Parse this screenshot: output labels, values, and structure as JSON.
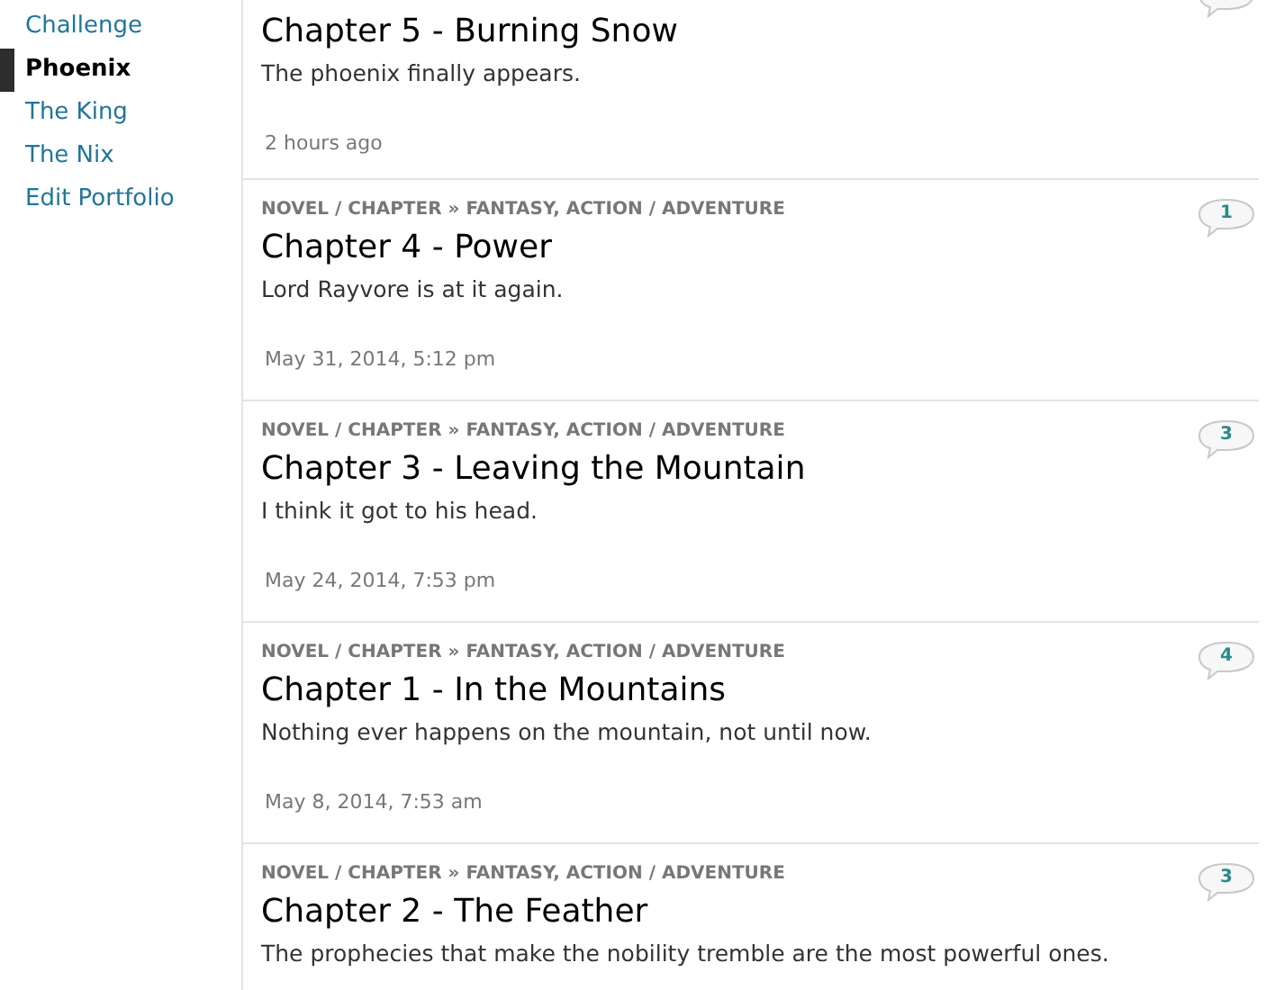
{
  "sidebar": {
    "items": [
      {
        "label": "Challenge",
        "selected": false
      },
      {
        "label": "Phoenix",
        "selected": true
      },
      {
        "label": "The King",
        "selected": false
      },
      {
        "label": "The Nix",
        "selected": false
      },
      {
        "label": "Edit Portfolio",
        "selected": false
      }
    ]
  },
  "posts": [
    {
      "title": "Chapter 5 - Burning Snow",
      "summary": "The phoenix finally appears.",
      "date": "2 hours ago"
    },
    {
      "meta": "NOVEL / CHAPTER » FANTASY, ACTION / ADVENTURE",
      "title": "Chapter 4 - Power",
      "summary": "Lord Rayvore is at it again.",
      "date": "May 31, 2014, 5:12 pm",
      "comments": "1"
    },
    {
      "meta": "NOVEL / CHAPTER » FANTASY, ACTION / ADVENTURE",
      "title": "Chapter 3 - Leaving the Mountain",
      "summary": "I think it got to his head.",
      "date": "May 24, 2014, 7:53 pm",
      "comments": "3"
    },
    {
      "meta": "NOVEL / CHAPTER » FANTASY, ACTION / ADVENTURE",
      "title": "Chapter 1 - In the Mountains",
      "summary": "Nothing ever happens on the mountain, not until now.",
      "date": "May 8, 2014, 7:53 am",
      "comments": "4"
    },
    {
      "meta": "NOVEL / CHAPTER » FANTASY, ACTION / ADVENTURE",
      "title": "Chapter 2 - The Feather",
      "summary": "The prophecies that make the nobility tremble are the most powerful ones.",
      "comments": "3"
    }
  ]
}
